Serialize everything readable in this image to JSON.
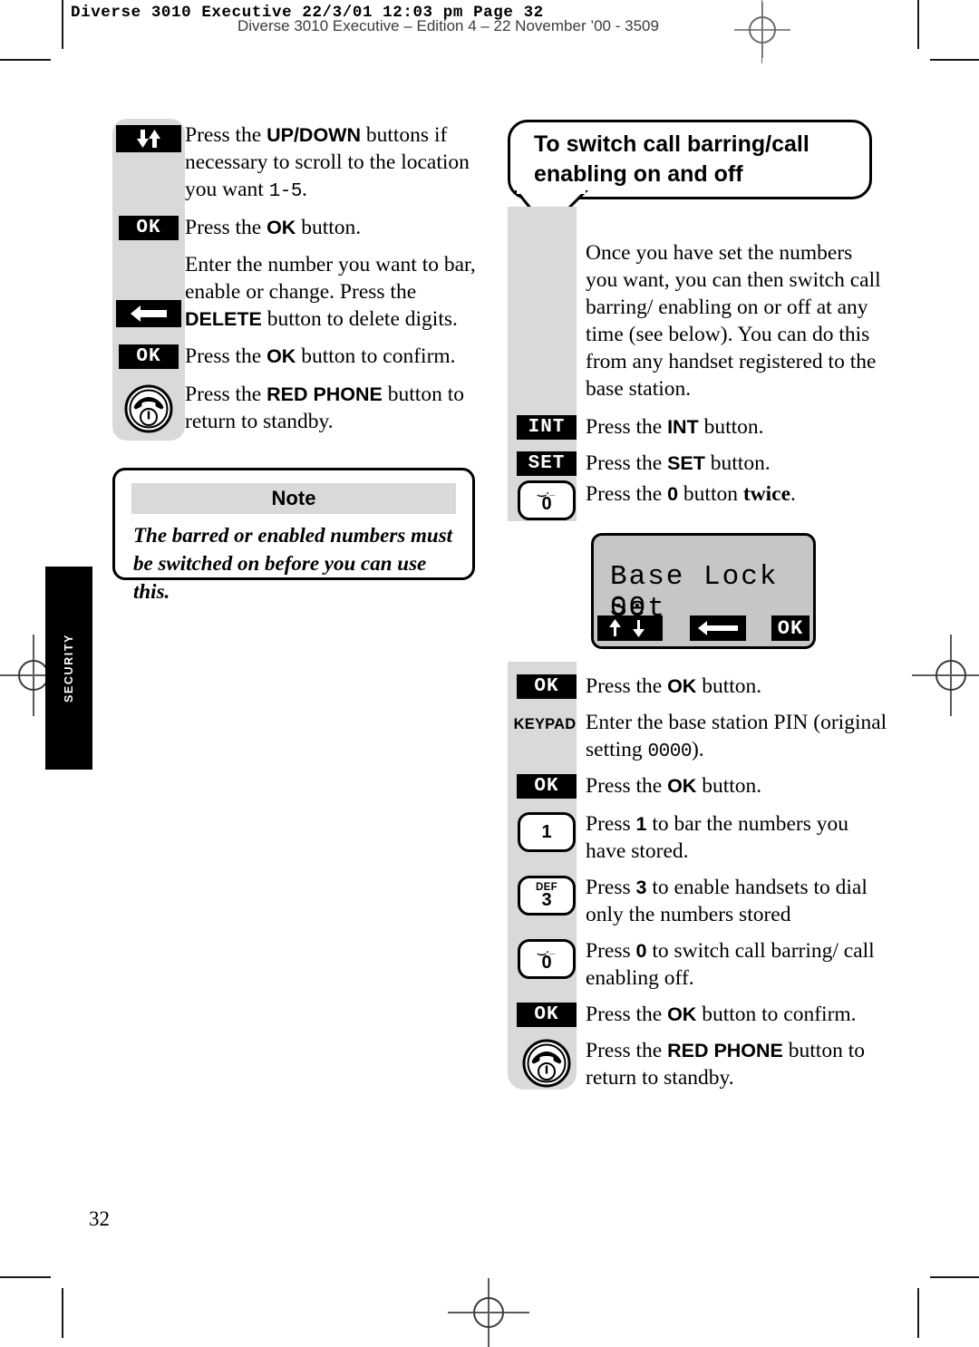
{
  "header": {
    "print_stamp": "Diverse 3010 Executive  22/3/01  12:03 pm  Page 32",
    "edition_line": "Diverse 3010 Executive – Edition 4 – 22 November ’00 - 3509"
  },
  "side_tab": {
    "label": "SECURITY"
  },
  "page_number": "32",
  "left_column": {
    "steps": [
      {
        "icon": "up-down-arrows-key",
        "text_parts": [
          {
            "t": "Press the ",
            "style": "normal"
          },
          {
            "t": "UP/DOWN",
            "style": "bold-sans"
          },
          {
            "t": " buttons if necessary to scroll to the location you want ",
            "style": "normal"
          },
          {
            "t": "1-5",
            "style": "mono"
          },
          {
            "t": ".",
            "style": "normal"
          }
        ],
        "plain": "Press the UP/DOWN buttons if necessary to scroll to the location you want 1-5."
      },
      {
        "icon": "ok-key",
        "icon_label": "OK",
        "plain": "Press the OK button."
      },
      {
        "icon": "delete-key",
        "plain": "Enter the number you want to bar, enable or change. Press the DELETE button to delete digits."
      },
      {
        "icon": "ok-key",
        "icon_label": "OK",
        "plain": "Press the OK button to confirm."
      },
      {
        "icon": "red-phone-key",
        "plain": "Press the RED PHONE button to return to standby."
      }
    ],
    "note": {
      "title": "Note",
      "body": "The barred or enabled numbers must be switched on before you can use this."
    }
  },
  "right_column": {
    "callout_title": "To switch call barring/call enabling on and off",
    "intro": "Once you have set the numbers you want, you can then switch call barring/ enabling on or off at any time (see below). You can do this from any handset registered to the base station.",
    "steps": [
      {
        "icon": "int-key",
        "icon_label": "INT",
        "plain": "Press the INT button."
      },
      {
        "icon": "set-key",
        "icon_label": "SET",
        "plain": "Press the SET button."
      },
      {
        "icon": "zero-key",
        "icon_label": "0",
        "plain": "Press the 0 button twice."
      }
    ],
    "lcd": {
      "line1": "Base Lock Set",
      "line2": "00",
      "softkeys": [
        "up-arrow",
        "down-arrow",
        "delete-arrow",
        "OK"
      ],
      "ok_label": "OK"
    },
    "steps2": [
      {
        "icon": "ok-key",
        "icon_label": "OK",
        "plain": "Press the OK button."
      },
      {
        "icon": "keypad-key",
        "icon_label": "KEYPAD",
        "plain": "Enter the base station PIN (original setting 0000)."
      },
      {
        "icon": "ok-key",
        "icon_label": "OK",
        "plain": "Press the OK button."
      },
      {
        "icon": "one-key",
        "icon_label": "1",
        "plain": "Press 1 to bar the numbers you have stored."
      },
      {
        "icon": "three-key",
        "icon_label": "3",
        "icon_sub": "DEF",
        "plain": "Press 3 to enable handsets to dial only the numbers stored"
      },
      {
        "icon": "zero-key",
        "icon_label": "0",
        "plain": "Press 0 to switch call barring/ call enabling off."
      },
      {
        "icon": "ok-key",
        "icon_label": "OK",
        "plain": "Press the OK button to confirm."
      },
      {
        "icon": "red-phone-key",
        "plain": "Press the RED PHONE button to return to standby."
      }
    ],
    "pin_value": "0000"
  },
  "colors": {
    "panel_grey": "#d9d9d9",
    "lcd_grey": "#c6c6c6",
    "ink": "#000000"
  }
}
